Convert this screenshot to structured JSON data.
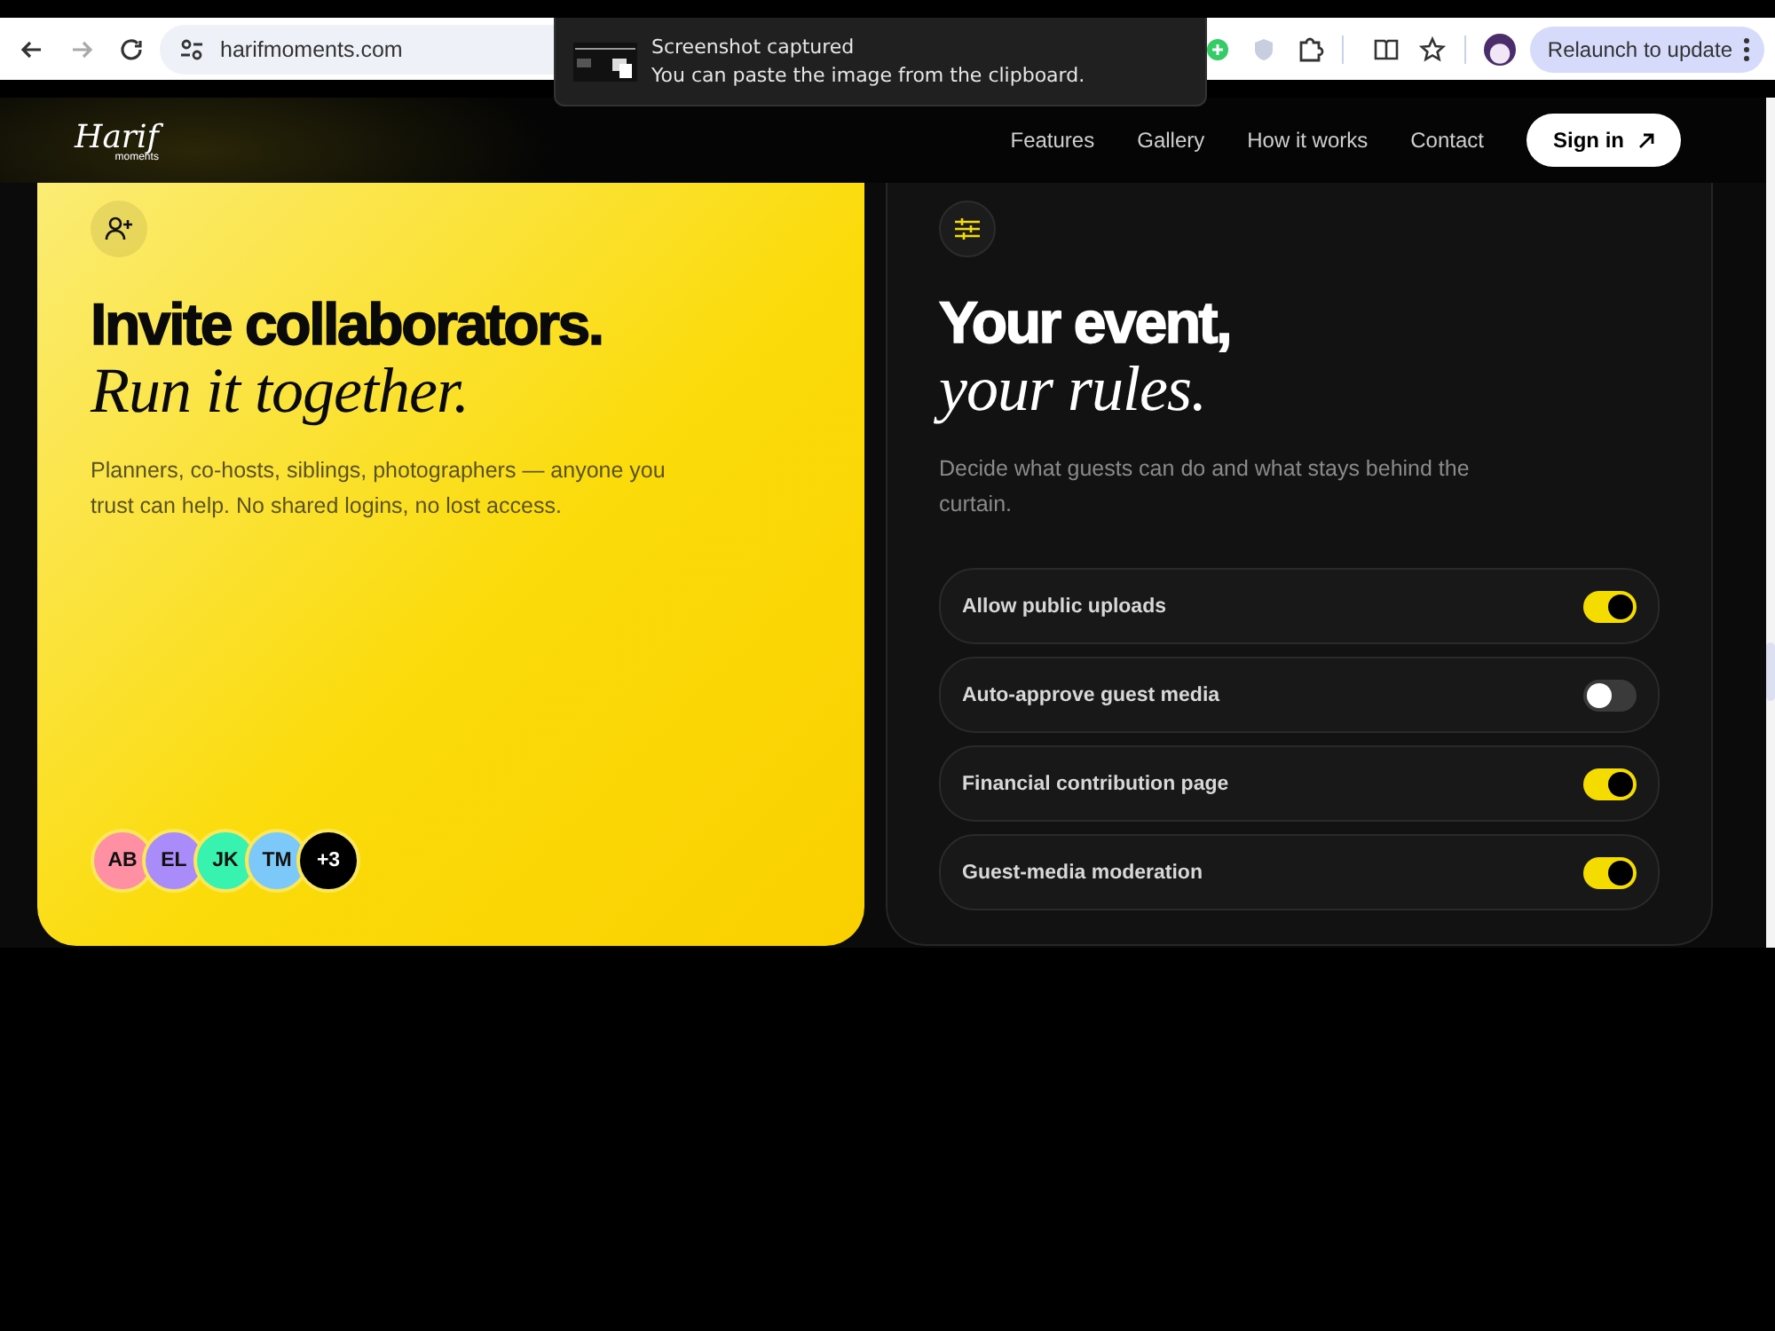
{
  "browser": {
    "url": "harifmoments.com",
    "relaunch_button": "Relaunch to update"
  },
  "notification": {
    "title": "Screenshot captured",
    "message": "You can paste the image from the clipboard."
  },
  "nav": {
    "logo": {
      "name": "Harif",
      "tagline": "moments"
    },
    "links": [
      "Features",
      "Gallery",
      "How it works",
      "Contact"
    ],
    "sign_in": "Sign in"
  },
  "invite_card": {
    "title": "Invite collaborators.",
    "subtitle": "Run it together.",
    "text": "Planners, co-hosts, siblings, photographers — anyone you trust can help. No shared logins, no lost access.",
    "avatars": [
      {
        "initials": "AB",
        "color": "#ff8fa3"
      },
      {
        "initials": "EL",
        "color": "#a98bfa"
      },
      {
        "initials": "JK",
        "color": "#38f2b0"
      },
      {
        "initials": "TM",
        "color": "#7cc8f8"
      },
      {
        "initials": "+3",
        "color": "#000000"
      }
    ]
  },
  "rules_card": {
    "title": "Your event,",
    "subtitle": "your rules.",
    "text": "Decide what guests can do and what stays behind the curtain.",
    "settings": [
      {
        "label": "Allow public uploads",
        "on": true
      },
      {
        "label": "Auto-approve guest media",
        "on": false
      },
      {
        "label": "Financial contribution page",
        "on": true
      },
      {
        "label": "Guest-media moderation",
        "on": true
      }
    ]
  }
}
